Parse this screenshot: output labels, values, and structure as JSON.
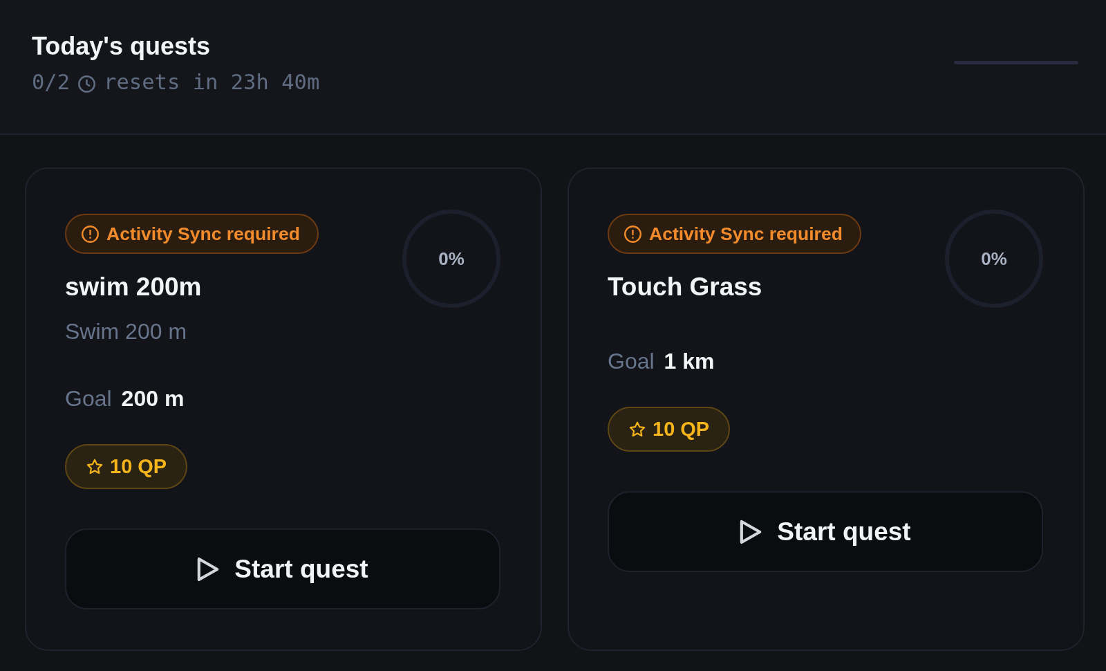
{
  "header": {
    "title": "Today's quests",
    "count": "0/2",
    "reset": "resets in 23h 40m",
    "progress": {
      "level": 0
    }
  },
  "quests": [
    {
      "notice": "Activity Sync required",
      "title": "swim 200m",
      "description": "Swim 200 m",
      "percent": "0%",
      "goal": {
        "label": "Goal",
        "value": "200 m"
      },
      "reward": "10 QP",
      "button": "Start quest"
    },
    {
      "notice": "Activity Sync required",
      "title": "Touch Grass",
      "percent": "0%",
      "goal": {
        "label": "Goal",
        "value": "1 km"
      },
      "reward": "10 QP",
      "button": "Start quest"
    }
  ]
}
